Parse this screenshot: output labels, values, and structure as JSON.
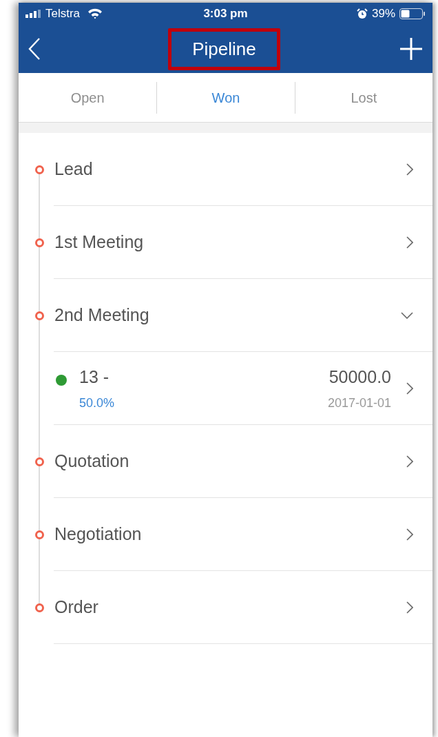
{
  "status_bar": {
    "carrier": "Telstra",
    "time": "3:03 pm",
    "battery": "39%"
  },
  "nav": {
    "title": "Pipeline",
    "highlighted": true
  },
  "tabs": [
    {
      "label": "Open",
      "selected": false
    },
    {
      "label": "Won",
      "selected": true
    },
    {
      "label": "Lost",
      "selected": false
    }
  ],
  "stages": [
    {
      "name": "Lead",
      "expanded": false
    },
    {
      "name": "1st Meeting",
      "expanded": false
    },
    {
      "name": "2nd Meeting",
      "expanded": true,
      "deals": [
        {
          "title": "13 -",
          "probability": "50.0%",
          "amount": "50000.0",
          "date": "2017-01-01",
          "color": "#2e9a34"
        }
      ]
    },
    {
      "name": "Quotation",
      "expanded": false
    },
    {
      "name": "Negotiation",
      "expanded": false
    },
    {
      "name": "Order",
      "expanded": false
    }
  ]
}
